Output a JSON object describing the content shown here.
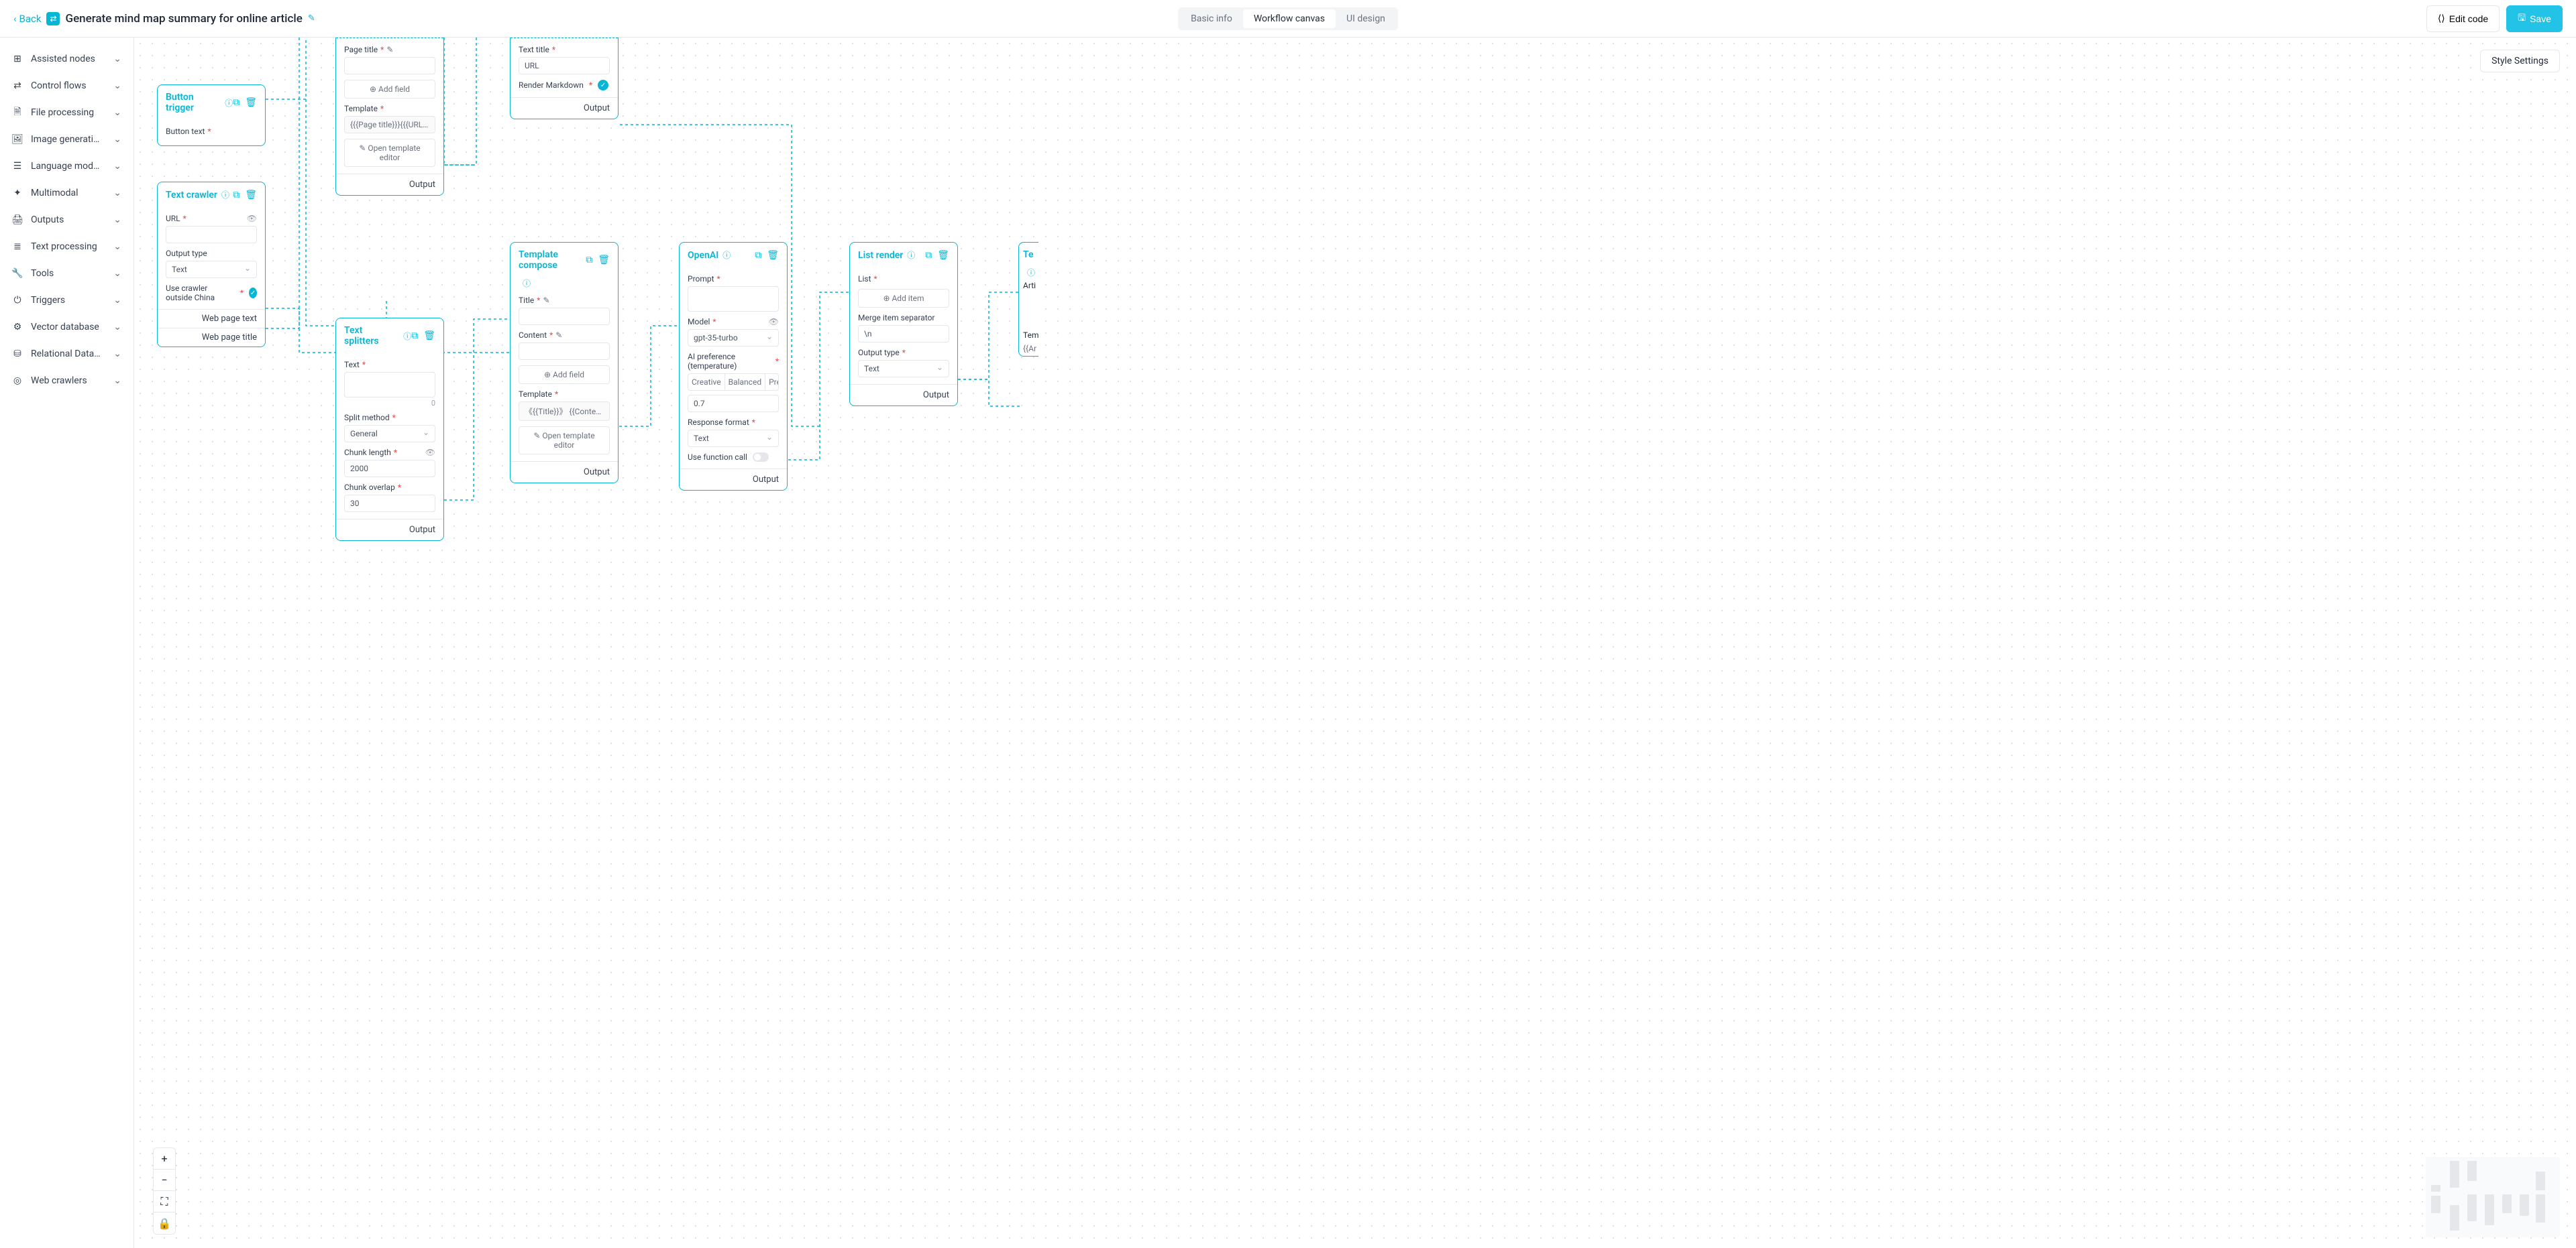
{
  "header": {
    "back": "Back",
    "title": "Generate mind map summary for online article",
    "tabs": {
      "basic": "Basic info",
      "canvas": "Workflow canvas",
      "ui": "UI design"
    },
    "edit_code": "Edit code",
    "save": "Save",
    "style_settings": "Style Settings"
  },
  "sidebar": {
    "items": [
      {
        "label": "Assisted nodes",
        "icon": "⊞"
      },
      {
        "label": "Control flows",
        "icon": "⇄"
      },
      {
        "label": "File processing",
        "icon": "🗎"
      },
      {
        "label": "Image generati…",
        "icon": "🖼"
      },
      {
        "label": "Language mod…",
        "icon": "☰"
      },
      {
        "label": "Multimodal",
        "icon": "✦"
      },
      {
        "label": "Outputs",
        "icon": "🖨"
      },
      {
        "label": "Text processing",
        "icon": "≣"
      },
      {
        "label": "Tools",
        "icon": "🔧"
      },
      {
        "label": "Triggers",
        "icon": "⏻"
      },
      {
        "label": "Vector database",
        "icon": "⚙"
      },
      {
        "label": "Relational Data…",
        "icon": "⛁"
      },
      {
        "label": "Web crawlers",
        "icon": "◎"
      }
    ]
  },
  "nodes": {
    "button_trigger": {
      "title": "Button trigger",
      "button_text_label": "Button text"
    },
    "text_crawler": {
      "title": "Text crawler",
      "url_label": "URL",
      "output_type_label": "Output type",
      "output_type_value": "Text",
      "outside_china_label": "Use crawler outside China",
      "out1": "Web page text",
      "out2": "Web page title"
    },
    "top_template": {
      "page_title_label": "Page title",
      "add_field": "Add field",
      "template_label": "Template",
      "template_value": "{{{Page title}}}{{{URL}}}",
      "open_editor": "Open template editor",
      "output": "Output"
    },
    "top_right": {
      "text_title_label": "Text title",
      "text_title_value": "URL",
      "render_md_label": "Render Markdown",
      "output": "Output"
    },
    "text_splitters": {
      "title": "Text splitters",
      "text_label": "Text",
      "counter": "0",
      "split_method_label": "Split method",
      "split_method_value": "General",
      "chunk_length_label": "Chunk length",
      "chunk_length_value": "2000",
      "chunk_overlap_label": "Chunk overlap",
      "chunk_overlap_value": "30",
      "output": "Output"
    },
    "template_compose": {
      "title": "Template compose",
      "title_field_label": "Title",
      "content_label": "Content",
      "add_field": "Add field",
      "template_label": "Template",
      "template_value": "《{{Title}}》 {{Content}} --- Please summari…",
      "open_editor": "Open template editor",
      "output": "Output"
    },
    "openai": {
      "title": "OpenAI",
      "prompt_label": "Prompt",
      "model_label": "Model",
      "model_value": "gpt-35-turbo",
      "ai_pref_label": "AI preference (temperature)",
      "seg": {
        "creative": "Creative",
        "balanced": "Balanced",
        "precise": "Precise"
      },
      "temp_value": "0.7",
      "resp_fmt_label": "Response format",
      "resp_fmt_value": "Text",
      "use_fn_label": "Use function call",
      "output": "Output"
    },
    "list_render": {
      "title": "List render",
      "list_label": "List",
      "add_item": "Add item",
      "merge_sep_label": "Merge item separator",
      "merge_sep_value": "\\n",
      "output_type_label": "Output type",
      "output_type_value": "Text",
      "output": "Output"
    },
    "cut_right": {
      "title_prefix": "Te",
      "arti": "Arti",
      "tem": "Tem",
      "ar": "{{Ar"
    }
  }
}
